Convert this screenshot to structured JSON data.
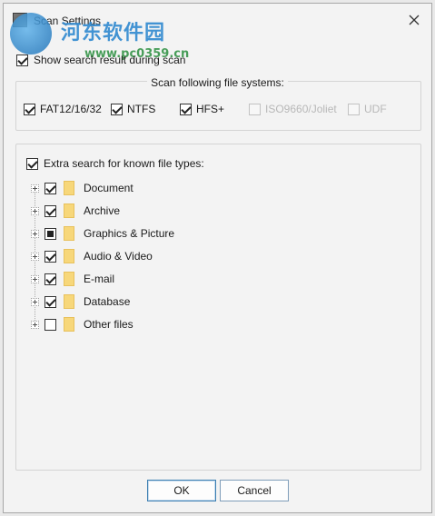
{
  "window": {
    "title": "Scan Settings",
    "close_glyph": "✕"
  },
  "watermark": {
    "text": "河东软件园",
    "url": "www.pc0359.cn"
  },
  "options": {
    "show_result_label": "Show search result during scan",
    "show_result_checked": true
  },
  "file_systems": {
    "legend": "Scan following file systems:",
    "items": [
      {
        "label": "FAT12/16/32",
        "checked": true,
        "enabled": true
      },
      {
        "label": "NTFS",
        "checked": true,
        "enabled": true
      },
      {
        "label": "HFS+",
        "checked": true,
        "enabled": true
      },
      {
        "label": "ISO9660/Joliet",
        "checked": false,
        "enabled": false
      },
      {
        "label": "UDF",
        "checked": false,
        "enabled": false
      }
    ]
  },
  "file_types": {
    "extra_label": "Extra search for known file types:",
    "extra_checked": true,
    "items": [
      {
        "label": "Document",
        "state": "checked"
      },
      {
        "label": "Archive",
        "state": "checked"
      },
      {
        "label": "Graphics & Picture",
        "state": "partial"
      },
      {
        "label": "Audio & Video",
        "state": "checked"
      },
      {
        "label": "E-mail",
        "state": "checked"
      },
      {
        "label": "Database",
        "state": "checked"
      },
      {
        "label": "Other files",
        "state": "unchecked"
      }
    ]
  },
  "buttons": {
    "ok": "OK",
    "cancel": "Cancel"
  }
}
